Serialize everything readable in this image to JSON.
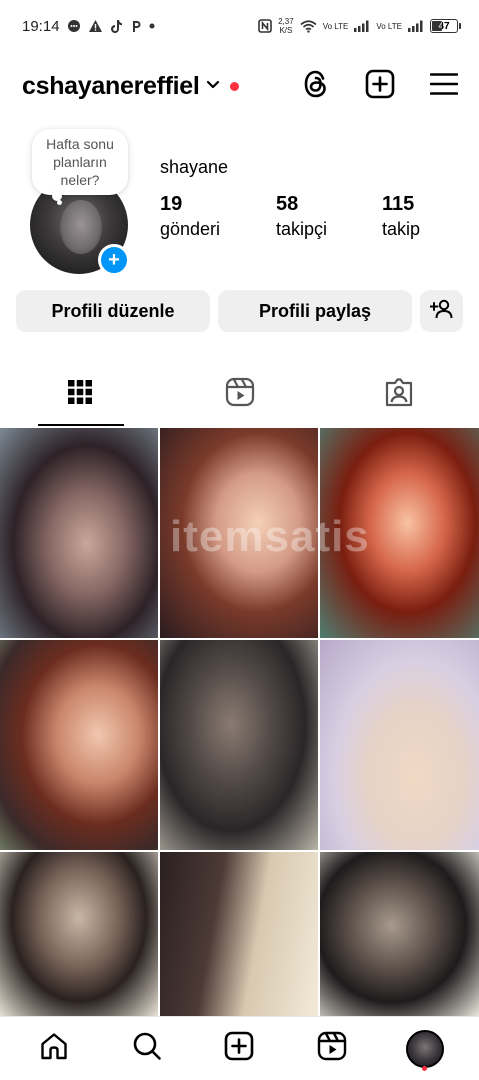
{
  "status_bar": {
    "time": "19:14",
    "net_speed_value": "2,37",
    "net_speed_unit": "K/S",
    "sim1": "Vo LTE",
    "sim2": "Vo LTE",
    "battery_level": "47",
    "battery_fraction": 0.47
  },
  "header": {
    "username": "cshayanereffiel",
    "icons": [
      "threads-icon",
      "create-icon",
      "menu-icon"
    ]
  },
  "profile": {
    "note_text": "Hafta sonu planların neler?",
    "display_name": "shayane",
    "stats": {
      "posts_count": "19",
      "posts_label": "gönderi",
      "followers_count": "58",
      "followers_label": "takipçi",
      "following_count": "115",
      "following_label": "takip"
    },
    "avatar_add": "+"
  },
  "actions": {
    "edit_label": "Profili düzenle",
    "share_label": "Profili paylaş"
  },
  "tabs": [
    "grid-tab",
    "reels-tab",
    "tagged-tab"
  ],
  "grid": {
    "watermark": "itemsatis"
  },
  "colors": {
    "accent_blue": "#0095f6",
    "notification_red": "#ff3040",
    "button_gray": "#efefef"
  }
}
